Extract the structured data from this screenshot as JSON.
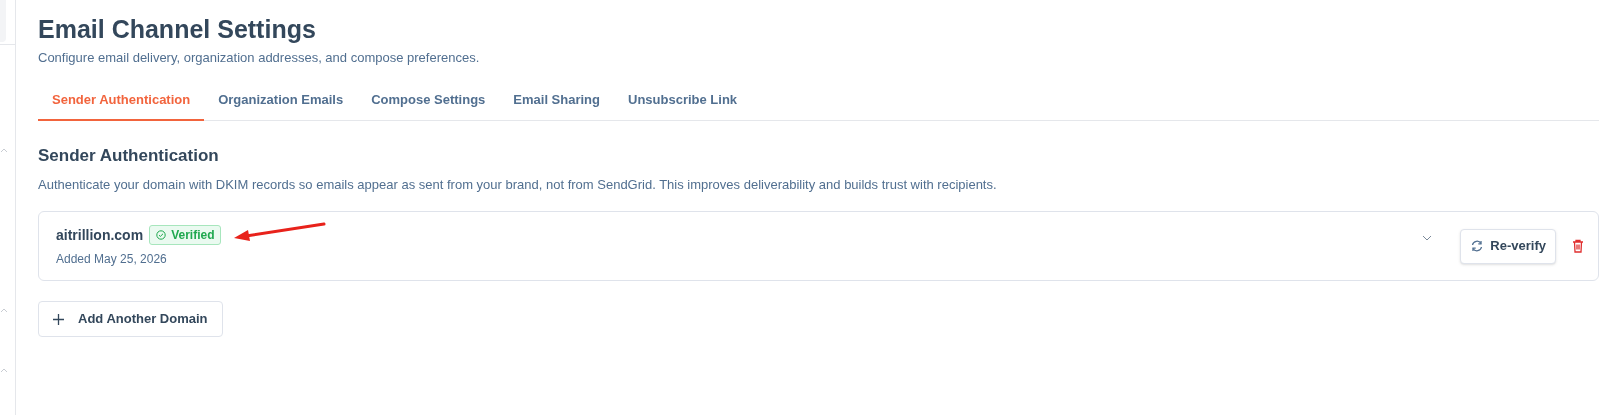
{
  "header": {
    "title": "Email Channel Settings",
    "subtitle": "Configure email delivery, organization addresses, and compose preferences."
  },
  "tabs": [
    {
      "label": "Sender Authentication",
      "selected": true
    },
    {
      "label": "Organization Emails",
      "selected": false
    },
    {
      "label": "Compose Settings",
      "selected": false
    },
    {
      "label": "Email Sharing",
      "selected": false
    },
    {
      "label": "Unsubscribe Link",
      "selected": false
    }
  ],
  "section": {
    "title": "Sender Authentication",
    "description": "Authenticate your domain with DKIM records so emails appear as sent from your brand, not from SendGrid. This improves deliverability and builds trust with recipients."
  },
  "domains": [
    {
      "domain": "aitrillion.com",
      "status": "Verified",
      "verified": true,
      "added": "Added May 25, 2026",
      "reverify_label": "Re-verify"
    }
  ],
  "add_button": "Add Another Domain"
}
